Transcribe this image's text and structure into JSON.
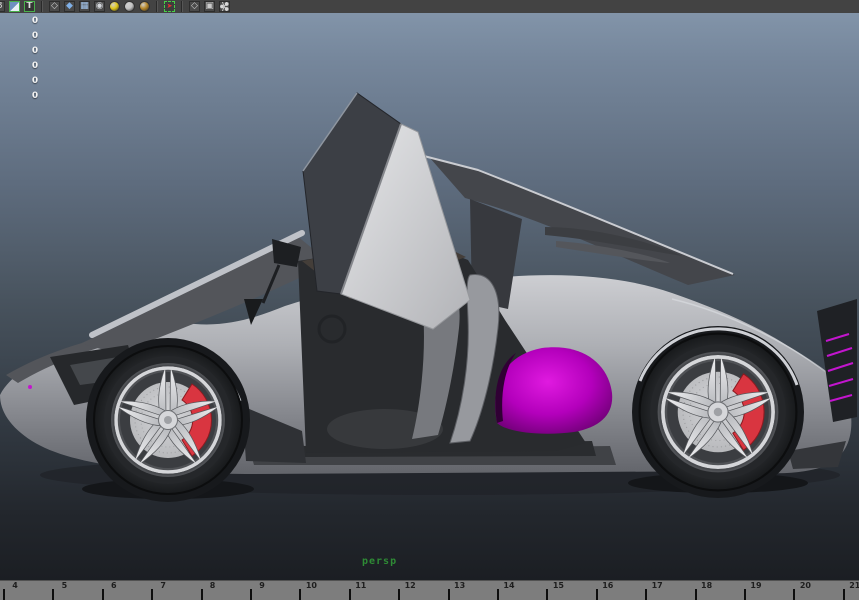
{
  "colors": {
    "toolbar_bg": "#434343",
    "bg_top": "#8294a9",
    "bg_bottom": "#1b1e23",
    "timeline_bg": "#7d7d7d",
    "camera_green": "#2e8b35",
    "accent_purple": "#c315ce",
    "intake_purple": "#b400bc",
    "caliper_red": "#d93540",
    "body_silver": "#aeb0b5"
  },
  "toolbar": {
    "icons": [
      {
        "name": "partial-letter-icon",
        "type": "partial",
        "glyph": "B"
      },
      {
        "name": "color-grid-icon",
        "type": "framed-color"
      },
      {
        "name": "text-tool-icon",
        "type": "framed-letter",
        "glyph": "T"
      },
      {
        "name": "separator",
        "type": "sep"
      },
      {
        "name": "wireframe-display-icon",
        "type": "cube-wire",
        "glyph": "◇"
      },
      {
        "name": "shaded-display-icon",
        "type": "cube-shaded",
        "glyph": "◆"
      },
      {
        "name": "textured-display-icon",
        "type": "cube-textured",
        "glyph": "▦"
      },
      {
        "name": "checker-material-icon",
        "type": "cube-checker",
        "glyph": "◉"
      },
      {
        "name": "default-lighting-icon",
        "type": "sphere",
        "color": "#e0c818"
      },
      {
        "name": "flat-lighting-icon",
        "type": "sphere",
        "color": "#c4c4c4"
      },
      {
        "name": "textured-lighting-icon",
        "type": "sphere",
        "color": "#b88828"
      },
      {
        "name": "separator",
        "type": "sep"
      },
      {
        "name": "isolate-select-icon",
        "type": "isolate",
        "glyph": "➤"
      },
      {
        "name": "separator",
        "type": "sep"
      },
      {
        "name": "xray-display-icon",
        "type": "cube-wire",
        "glyph": "◇"
      },
      {
        "name": "frame-selected-icon",
        "type": "frame",
        "glyph": "▣"
      },
      {
        "name": "joint-display-icon",
        "type": "share"
      }
    ]
  },
  "viewport": {
    "hud_values": [
      "0",
      "0",
      "0",
      "0",
      "0",
      "0"
    ],
    "camera_label": "persp"
  },
  "timeline": {
    "frames": [
      "4",
      "5",
      "6",
      "7",
      "8",
      "9",
      "10",
      "11",
      "12",
      "13",
      "14",
      "15",
      "16",
      "17",
      "18",
      "19",
      "20",
      "21"
    ]
  }
}
